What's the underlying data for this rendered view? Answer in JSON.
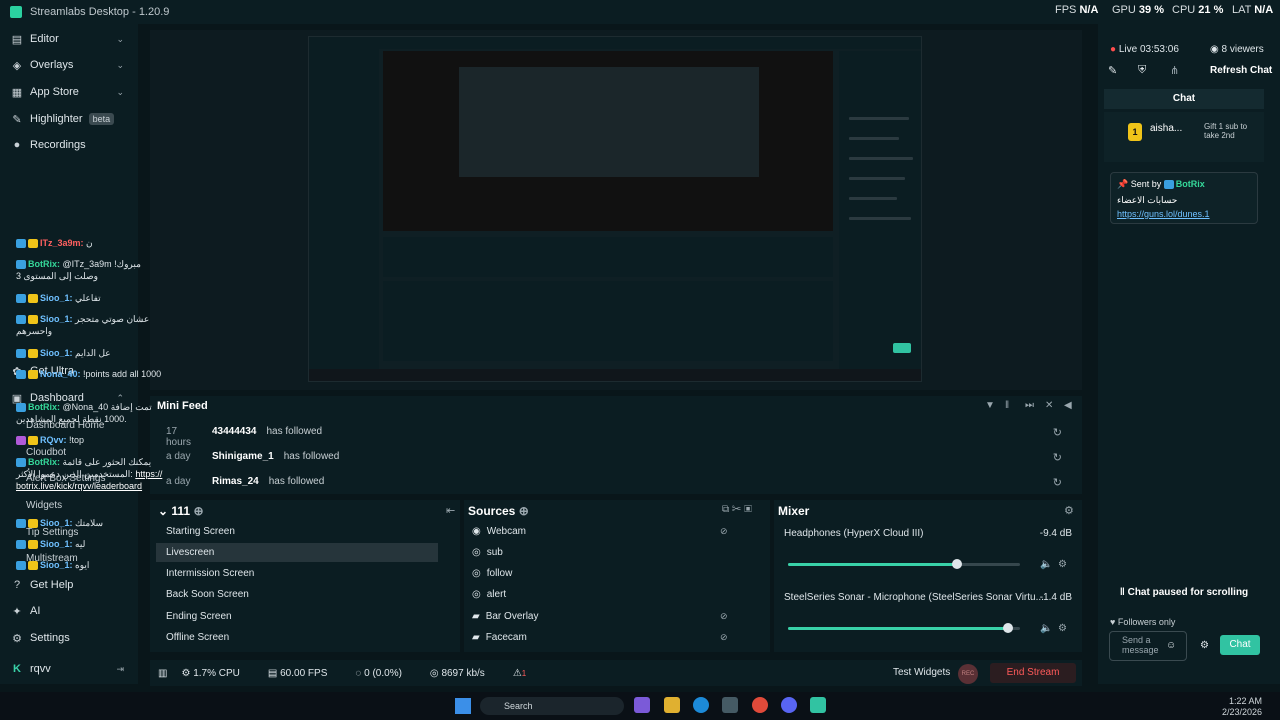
{
  "window": {
    "title": "Streamlabs Desktop - 1.20.9"
  },
  "stats": {
    "fps_label": "FPS",
    "fps": "N/A",
    "gpu_label": "GPU",
    "gpu": "39 %",
    "cpu_label": "CPU",
    "cpu": "21 %",
    "lat_label": "LAT",
    "lat": "N/A"
  },
  "sidebar": {
    "editor": "Editor",
    "overlays": "Overlays",
    "app_store": "App Store",
    "highlighter": "Highlighter",
    "highlighter_badge": "beta",
    "recordings": "Recordings",
    "get_ultra": "Get Ultra",
    "dashboard": "Dashboard",
    "dashboard_home": "Dashboard Home",
    "cloudbot": "Cloudbot",
    "alert_box": "Alert Box Settings",
    "widgets": "Widgets",
    "tip_settings": "Tip Settings",
    "multistream": "Multistream",
    "get_help": "Get Help",
    "ai": "AI",
    "settings": "Settings",
    "user": "rqvv"
  },
  "minifeed": {
    "title": "Mini Feed",
    "rows": [
      {
        "time": "17 hours",
        "name": "43444434",
        "action": "has followed"
      },
      {
        "time": "a day",
        "name": "Shinigame_1",
        "action": "has followed"
      },
      {
        "time": "a day",
        "name": "Rimas_24",
        "action": "has followed"
      }
    ]
  },
  "scenes": {
    "collection": "111",
    "items": [
      "Starting Screen",
      "Livescreen",
      "Intermission Screen",
      "Back Soon Screen",
      "Ending Screen",
      "Offline Screen"
    ],
    "selected": "Livescreen"
  },
  "sources": {
    "title": "Sources",
    "items": [
      "Webcam",
      "sub",
      "follow",
      "alert",
      "Bar Overlay",
      "Facecam"
    ]
  },
  "mixer": {
    "title": "Mixer",
    "channels": [
      {
        "name": "Headphones (HyperX Cloud III)",
        "db": "-9.4 dB",
        "level": 0.73
      },
      {
        "name": "SteelSeries Sonar - Microphone (SteelSeries Sonar Virtu...",
        "db": "-1.4 dB",
        "level": 0.95
      }
    ]
  },
  "status": {
    "cpu": "1.7% CPU",
    "fps": "60.00 FPS",
    "dropped": "0 (0.0%)",
    "bitrate": "8697 kb/s",
    "alerts": "1",
    "test_widgets": "Test Widgets",
    "rec": "REC",
    "end_stream": "End Stream"
  },
  "chat": {
    "live": "Live 03:53:06",
    "viewers": "8 viewers",
    "refresh": "Refresh Chat",
    "title": "Chat",
    "gift_user": "aisha...",
    "gift_count": "1",
    "gift_text": "Gift 1 sub to take 2nd",
    "pinned_sent_by": "Sent by",
    "pinned_user": "BotRix",
    "pinned_line": "حسابات الاعضاء",
    "pinned_link": "https://guns.lol/dunes.1",
    "messages": [
      {
        "user": "ITz_3a9m:",
        "text": "ن",
        "kind": "red"
      },
      {
        "user": "BotRix:",
        "text": "@ITz_3a9m مبروك! وصلت إلى المستوى 3",
        "kind": "bot"
      },
      {
        "user": "Sioo_1:",
        "text": "تفاعلي",
        "kind": "who"
      },
      {
        "user": "Sioo_1:",
        "text": "عشان صوتي متحجر واحسرهم",
        "kind": "who"
      },
      {
        "user": "Sioo_1:",
        "text": "عل الدايم",
        "kind": "who"
      },
      {
        "user": "Nona_40:",
        "text": "!points add all 1000",
        "kind": "who"
      },
      {
        "user": "BotRix:",
        "text": "@Nona_40 تمت إضافة 1000 نقطة لجميع المشاهدين.",
        "kind": "bot"
      },
      {
        "user": "RQvv:",
        "text": "!top",
        "kind": "who"
      },
      {
        "user": "BotRix:",
        "text": "يمكنك الحثور على قائمة المستخدمين الذين دعموا الأكثر:",
        "link": "https://botrix.live/kick/rqvv/leaderboard",
        "kind": "bot"
      },
      {
        "user": "Sioo_1:",
        "text": "سلامتك",
        "kind": "who"
      },
      {
        "user": "Sioo_1:",
        "text": "ليه",
        "kind": "who"
      },
      {
        "user": "Sioo_1:",
        "text": "ايوه",
        "kind": "who"
      }
    ],
    "paused": "Chat paused for scrolling",
    "followers_only": "Followers only",
    "input_placeholder": "Send a message",
    "send": "Chat"
  },
  "taskbar": {
    "search": "Search",
    "time": "1:22 AM",
    "date": "2/23/2026"
  },
  "colors": {
    "accent": "#31c3a2",
    "bg": "#09161a",
    "panel": "#0b1d22",
    "danger": "#ff5a5a"
  }
}
